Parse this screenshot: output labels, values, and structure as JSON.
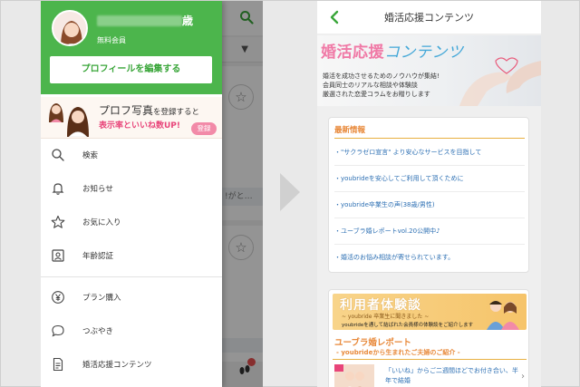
{
  "left_screen": {
    "drawer": {
      "name_suffix": "歳",
      "member_type": "無料会員",
      "edit_profile_label": "プロフィールを編集する",
      "promo": {
        "line1_big": "プロフ写真",
        "line1_small": "を登録する",
        "line1_end": "と",
        "line2_highlight": "表示率といいね数UP!",
        "register_label": "登録"
      },
      "menu": [
        {
          "label": "検索",
          "icon": "search-icon"
        },
        {
          "label": "お知らせ",
          "icon": "bell-icon"
        },
        {
          "label": "お気に入り",
          "icon": "star-icon"
        },
        {
          "label": "年齢認証",
          "icon": "id-card-icon"
        },
        {
          "label": "プラン購入",
          "icon": "yen-icon"
        },
        {
          "label": "つぶやき",
          "icon": "speech-bubble-icon"
        },
        {
          "label": "婚活応援コンテンツ",
          "icon": "document-icon"
        }
      ]
    },
    "background": {
      "snippet": "!がと…"
    }
  },
  "right_screen": {
    "title": "婚活応援コンテンツ",
    "banner": {
      "title_pink": "婚活応援",
      "title_blue": "コンテンツ",
      "lines": [
        "婚活を成功させるためのノウハウが集結!",
        "会員同士のリアルな相談や体験談",
        "厳選された恋愛コラムをお贈りします"
      ]
    },
    "news": {
      "heading": "最新情報",
      "items": [
        "・\"サクラゼロ宣言\" より安心なサービスを目指して",
        "・youbrideを安心してご利用して頂くために",
        "・youbride卒業生の声(38歳/男性)",
        "・ユーブラ婚レポートvol.20公開中♪",
        "・婚活のお悩み相談が寄せられています。"
      ]
    },
    "experience": {
      "banner_title": "利用者体験談",
      "banner_sub": "~ youbride 卒業生に聞きました ~",
      "banner_line": "youbrideを通して結ばれた会員様の体験談をご紹介します",
      "report_title": "ユーブラ婚レポート",
      "report_sub": "- youbrideから生まれたご夫婦のご紹介 -",
      "report_text": "「いいね」からご二週間ほどでお付き合い、半年で結婚"
    }
  },
  "colors": {
    "brand_green": "#4cb54c",
    "accent_pink": "#f079a6",
    "accent_orange": "#e8893a",
    "link_blue": "#2c6fb3"
  }
}
